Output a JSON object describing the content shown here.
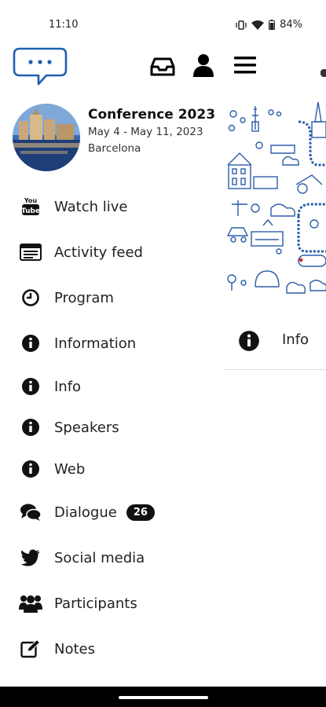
{
  "status": {
    "time": "11:10",
    "battery": "84%"
  },
  "event": {
    "title": "Conference 2023",
    "dates": "May 4 - May 11, 2023",
    "location": "Barcelona"
  },
  "menu": [
    {
      "label": "Watch live",
      "icon": "youtube-icon"
    },
    {
      "label": "Activity feed",
      "icon": "feed-icon"
    },
    {
      "label": "Program",
      "icon": "clock-icon"
    },
    {
      "label": "Information",
      "icon": "info-icon"
    },
    {
      "label": "Info",
      "icon": "info-icon"
    },
    {
      "label": "Speakers",
      "icon": "info-icon"
    },
    {
      "label": "Web",
      "icon": "info-icon"
    },
    {
      "label": "Dialogue",
      "icon": "comments-icon",
      "badge": "26"
    },
    {
      "label": "Social media",
      "icon": "twitter-icon"
    },
    {
      "label": "Participants",
      "icon": "users-icon"
    },
    {
      "label": "Notes",
      "icon": "edit-icon"
    }
  ],
  "right_panel": {
    "info_label": "Info"
  },
  "colors": {
    "brand_blue": "#1f5fb3",
    "illustration_blue": "#2b5ea8"
  }
}
